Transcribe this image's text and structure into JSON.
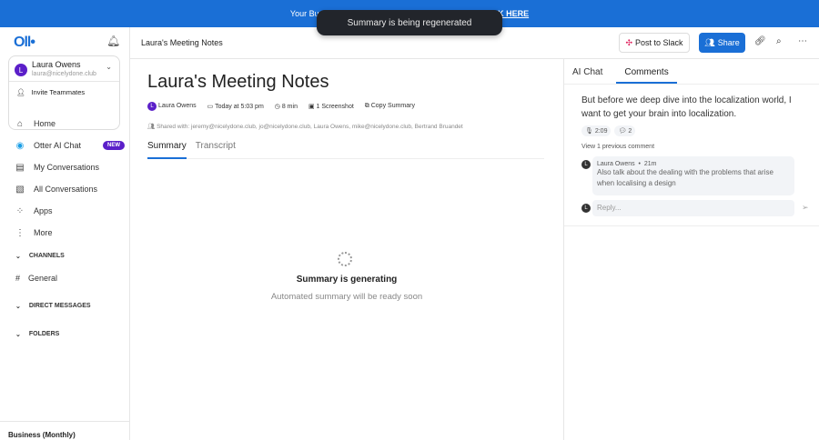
{
  "banner": {
    "left": "Your Bu",
    "right": "CK HERE"
  },
  "toast": "Summary is being regenerated",
  "sidebar": {
    "logo": "Oll•",
    "user": {
      "initial": "L",
      "name": "Laura Owens",
      "email": "laura@nicelydone.club"
    },
    "invite": "Invite Teammates",
    "items": [
      {
        "label": "Home",
        "icon": "⌂"
      },
      {
        "label": "Otter AI Chat",
        "icon": "◉",
        "badge": "NEW"
      },
      {
        "label": "My Conversations",
        "icon": "▤"
      },
      {
        "label": "All Conversations",
        "icon": "▧"
      },
      {
        "label": "Apps",
        "icon": "⁘"
      },
      {
        "label": "More",
        "icon": "⋮"
      }
    ],
    "channels": "CHANNELS",
    "general": "General",
    "dms": "DIRECT MESSAGES",
    "folders": "FOLDERS",
    "plan": "Business (Monthly)"
  },
  "topbar": {
    "title": "Laura's Meeting Notes",
    "slack": "Post to Slack",
    "share": "Share"
  },
  "main": {
    "title": "Laura's Meeting Notes",
    "owner": "Laura Owens",
    "date": "Today at 5:03 pm",
    "duration": "8 min",
    "screenshots": "1 Screenshot",
    "copy": "Copy Summary",
    "shared": "Shared with: jeremy@nicelydone.club, jo@nicelydone.club, Laura Owens, mike@nicelydone.club, Bertrand Bruandet",
    "tabs": [
      "Summary",
      "Transcript"
    ],
    "gen_title": "Summary is generating",
    "gen_sub": "Automated summary will be ready soon"
  },
  "right": {
    "tabs": [
      "AI Chat",
      "Comments"
    ],
    "quote": "But before we deep dive into the localization world, I want to get your brain into localization.",
    "time": "2:09",
    "count": "2",
    "view_prev": "View 1 previous comment",
    "comment": {
      "initial": "L",
      "author": "Laura Owens",
      "age": "21m",
      "text": "Also talk about the dealing with the problems that arise when localising a design"
    },
    "reply_placeholder": "Reply..."
  }
}
